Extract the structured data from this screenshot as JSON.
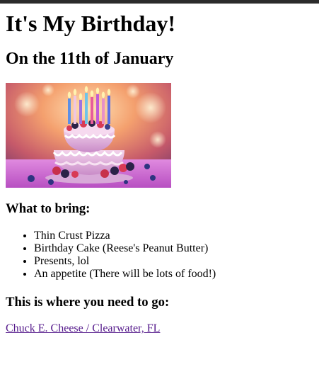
{
  "header": {
    "title": "It's My Birthday!",
    "subtitle": "On the 11th of January"
  },
  "image": {
    "subject": "birthday-cake-with-candles-and-berries"
  },
  "bring": {
    "heading": "What to bring:",
    "items": [
      "Thin Crust Pizza",
      "Birthday Cake (Reese's Peanut Butter)",
      "Presents, lol",
      "An appetite (There will be lots of food!)"
    ]
  },
  "location": {
    "heading": "This is where you need to go:",
    "link_text": "Chuck E. Cheese / Clearwater, FL"
  },
  "colors": {
    "link_visited": "#551a8b",
    "top_bar": "#2b2b2b"
  }
}
